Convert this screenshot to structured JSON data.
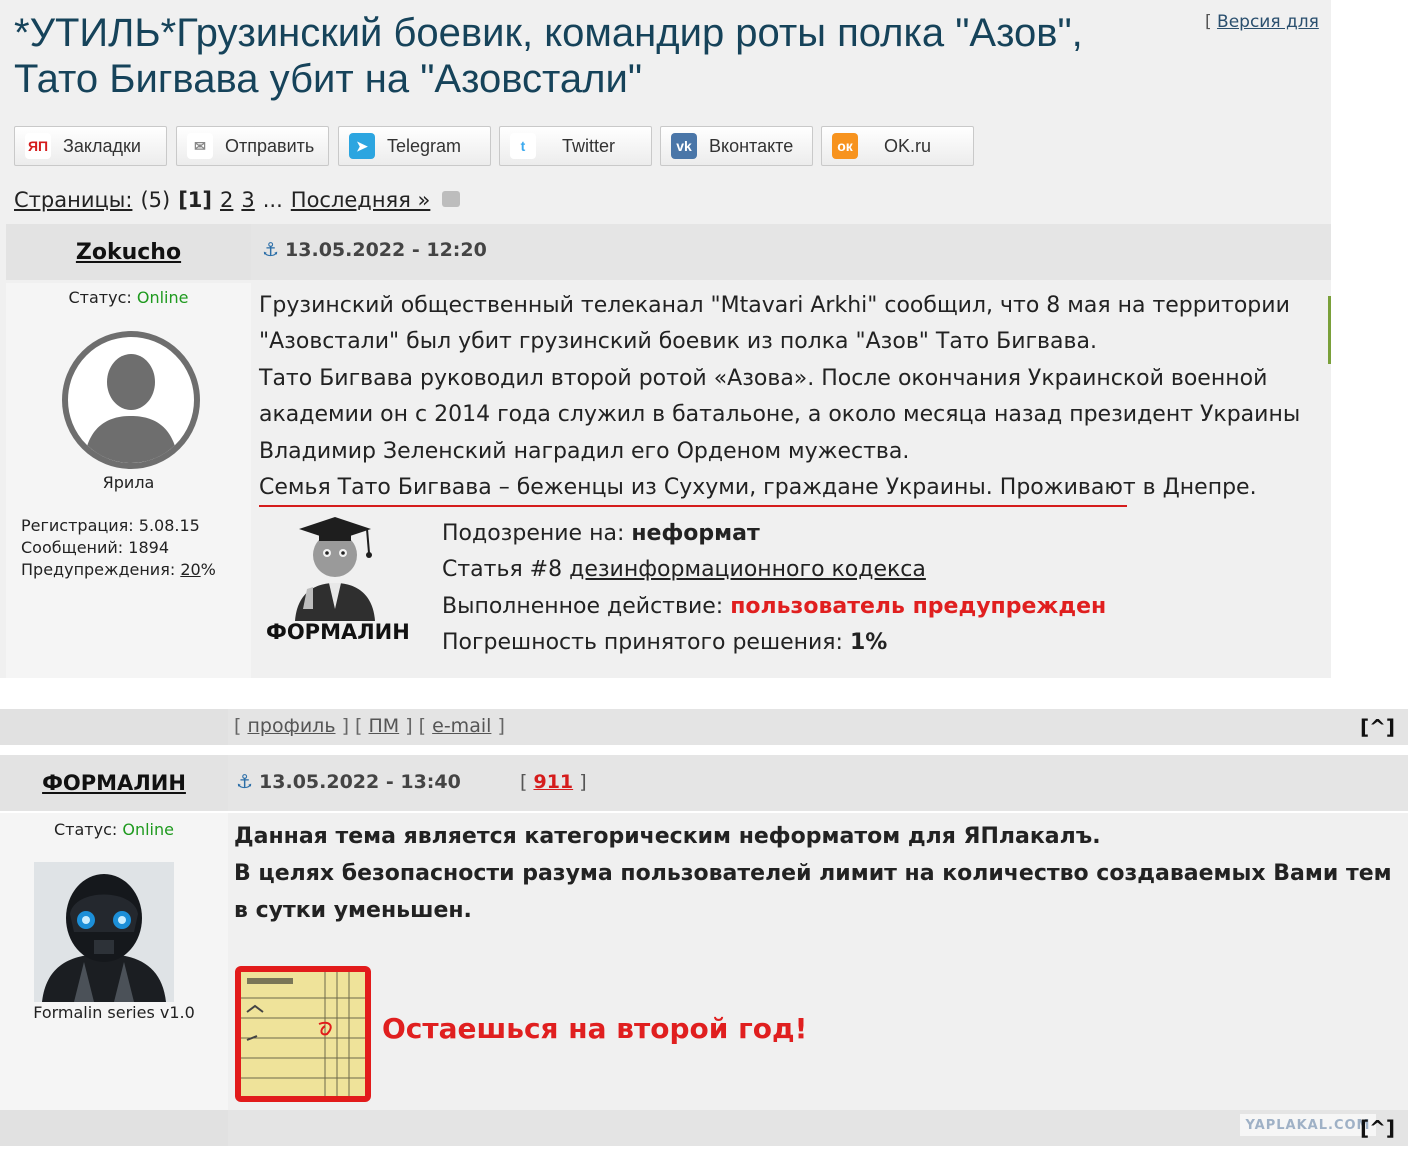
{
  "topic": {
    "title": "*УТИЛЬ*Грузинский боевик, командир роты полка \"Азов\", Тато Бигвава убит на \"Азовстали\"",
    "version_bracket_open": "[",
    "version_link": "Версия для"
  },
  "share_buttons": [
    {
      "label": "Закладки",
      "icon": "yandex-bookmark-icon",
      "icon_text": "ЯП",
      "color": "#ffffff",
      "text_color": "#d51c1c"
    },
    {
      "label": "Отправить",
      "icon": "envelope-icon",
      "icon_text": "✉",
      "color": "#ffffff",
      "text_color": "#888888"
    },
    {
      "label": "Telegram",
      "icon": "telegram-icon",
      "icon_text": "➤",
      "color": "#2ca5e0",
      "text_color": "#ffffff"
    },
    {
      "label": "Twitter",
      "icon": "twitter-icon",
      "icon_text": "t",
      "color": "#ffffff",
      "text_color": "#3ba9ee"
    },
    {
      "label": "Вконтакте",
      "icon": "vk-icon",
      "icon_text": "vk",
      "color": "#4a76a8",
      "text_color": "#ffffff"
    },
    {
      "label": "OK.ru",
      "icon": "odnoklassniki-icon",
      "icon_text": "ок",
      "color": "#f7931e",
      "text_color": "#ffffff"
    }
  ],
  "pagination": {
    "label": "Страницы:",
    "count": "(5)",
    "current": "[1]",
    "pages": [
      "2",
      "3"
    ],
    "ellipsis": "...",
    "last": "Последняя »"
  },
  "post1": {
    "author": "Zokucho",
    "date": "13.05.2022 - 12:20",
    "status_label": "Статус:",
    "status_value": "Online",
    "rank": "Ярила",
    "reg_label": "Регистрация:",
    "reg_value": "5.08.15",
    "msgs_label": "Сообщений:",
    "msgs_value": "1894",
    "warn_label": "Предупреждения:",
    "warn_value": "20",
    "warn_suffix": "%",
    "body": [
      "Грузинский общественный телеканал \"Mtavari Arkhi\" сообщил, что 8 мая на территории",
      "\"Азовстали\" был убит грузинский боевик из полка \"Азов\" Тато Бигвава.",
      "Тато Бигвава руководил второй ротой «Азова». После окончания Украинской военной",
      "академии он с 2014 года служил в батальоне, а около месяца назад президент Украины",
      "Владимир Зеленский наградил его Орденом мужества.",
      "Семья Тато Бигвава – беженцы из Сухуми, граждане Украины. Проживают в Днепре."
    ],
    "moderation": {
      "moderator": "ФОРМАЛИН",
      "suspicion_label": "Подозрение на:",
      "suspicion_value": "неформат",
      "article_label": "Статья #8",
      "article_link": "дезинформационного кодекса",
      "action_label": "Выполненное действие:",
      "action_value": "пользователь предупрежден",
      "error_label": "Погрешность принятого решения:",
      "error_value": "1%"
    }
  },
  "post_links": {
    "open1": "[",
    "profile": "профиль",
    "sep1": "] [",
    "pm": "ПМ",
    "sep2": "] [",
    "email": "e-mail",
    "close": "]",
    "to_top": "[^]"
  },
  "post2": {
    "author": "ФОРМАЛИН",
    "date": "13.05.2022 - 13:40",
    "rep_open": "[",
    "rep_value": "911",
    "rep_close": "]",
    "status_label": "Статус:",
    "status_value": "Online",
    "rank": "Formalin series v1.0",
    "body": [
      "Данная тема является категорическим неформатом для ЯПлакалъ.",
      "В целях безопасности разума пользователей лимит на количество создаваемых Вами тем в сутки уменьшен."
    ],
    "slogan": "Остаешься на второй год!"
  },
  "footer": {
    "watermark": "YAPLAKAL.COM",
    "to_top": "[^]"
  }
}
